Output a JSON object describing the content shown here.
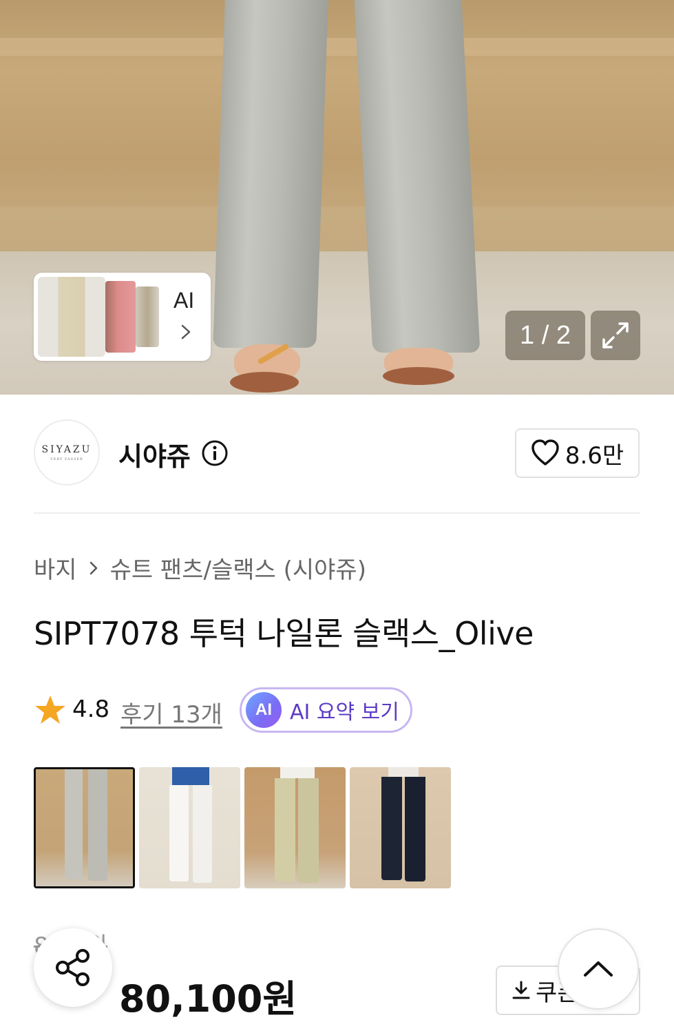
{
  "gallery": {
    "ai_card_label": "AI",
    "counter": "1 / 2"
  },
  "shop": {
    "logo_text": "SIYAZU",
    "logo_subtext": "VERY FASSER",
    "name": "시야쥬",
    "like_count": "8.6만"
  },
  "category": {
    "level1": "바지",
    "level2": "슈트 팬츠/슬랙스 (시야쥬)"
  },
  "product": {
    "title": "SIPT7078 투턱 나일론 슬랙스_Olive",
    "rating": "4.8",
    "reviews": "후기 13개",
    "ai_badge": "AI",
    "ai_summary": "AI 요약 보기"
  },
  "thumbnails": [
    {
      "name": "light-gray",
      "selected": true
    },
    {
      "name": "white",
      "selected": false
    },
    {
      "name": "olive",
      "selected": false
    },
    {
      "name": "navy",
      "selected": false
    }
  ],
  "price": {
    "original": "8  00원",
    "discount": "",
    "final": "80,100원",
    "coupon_label": "쿠폰"
  },
  "icons": {
    "expand": "expand-icon",
    "info": "info-icon",
    "heart": "heart-icon",
    "star": "star-icon",
    "share": "share-icon",
    "scroll_top": "chevron-up-icon",
    "download": "download-icon"
  },
  "colors": {
    "star": "#f5a623",
    "discount": "#f24040",
    "ai_purple": "#5b3bc4"
  }
}
